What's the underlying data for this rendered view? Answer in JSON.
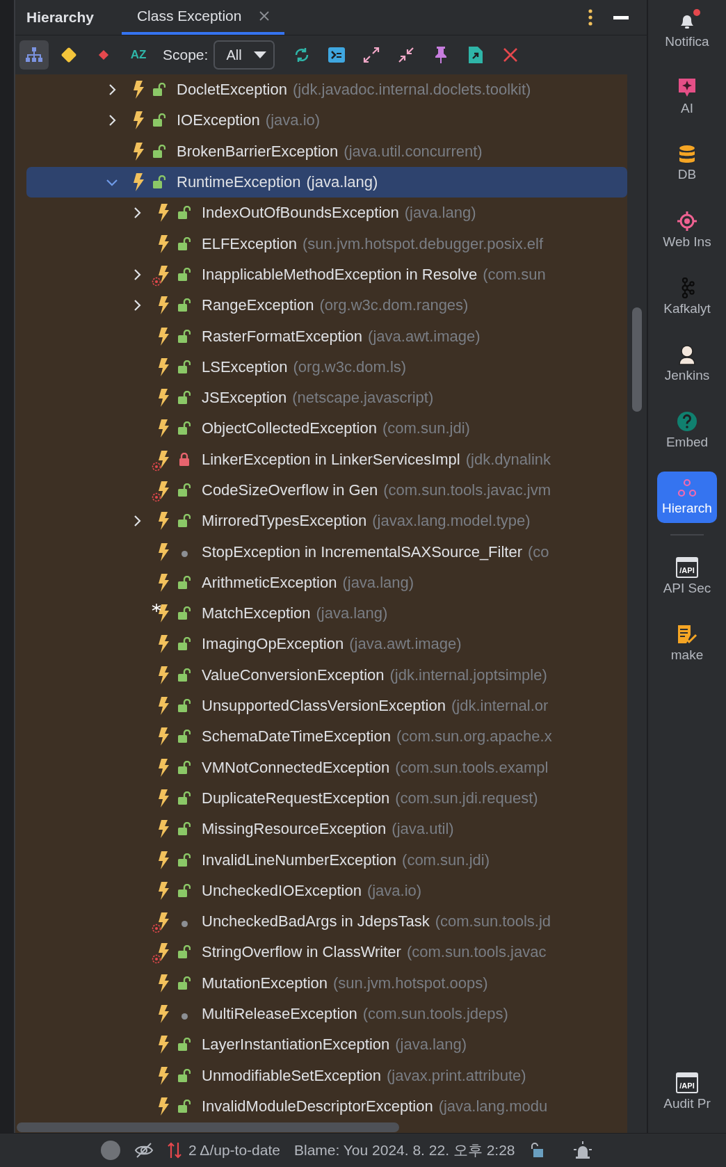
{
  "panel": {
    "title": "Hierarchy",
    "tabs": [
      {
        "label": "Class Exception",
        "selected": true
      }
    ]
  },
  "toolbar": {
    "buttons": [
      {
        "kind": "hierarchy",
        "selected": true
      },
      {
        "kind": "diamond",
        "selected": false
      },
      {
        "kind": "small-diamond",
        "selected": false
      },
      {
        "kind": "sort",
        "label": "AZ",
        "selected": false
      }
    ],
    "scope": {
      "label": "Scope:",
      "value": "All"
    },
    "actions": [
      {
        "kind": "refresh"
      },
      {
        "kind": "terminal"
      },
      {
        "kind": "expand"
      },
      {
        "kind": "collapse"
      },
      {
        "kind": "pin"
      },
      {
        "kind": "export"
      },
      {
        "kind": "close"
      }
    ]
  },
  "tree": [
    {
      "name": "DocletException",
      "package": "(jdk.javadoc.internal.doclets.toolkit)",
      "kind": "public",
      "expanded": false,
      "selected": false,
      "badge_target": false,
      "badge_asterisk": false
    },
    {
      "name": "IOException",
      "package": "(java.io)",
      "kind": "public",
      "expanded": false,
      "selected": false,
      "badge_target": false,
      "badge_asterisk": false
    },
    {
      "name": "BrokenBarrierException",
      "package": "(java.util.concurrent)",
      "kind": "public",
      "selected": false,
      "badge_target": false,
      "badge_asterisk": false
    },
    {
      "name": "RuntimeException",
      "package": "(java.lang)",
      "kind": "public",
      "expanded": true,
      "selected": true,
      "badge_target": false,
      "badge_asterisk": false,
      "children": [
        {
          "name": "IndexOutOfBoundsException",
          "package": "(java.lang)",
          "kind": "public",
          "expanded": false,
          "selected": false,
          "badge_target": false,
          "badge_asterisk": false
        },
        {
          "name": "ELFException",
          "package": "(sun.jvm.hotspot.debugger.posix.elf",
          "kind": "public",
          "selected": false,
          "badge_target": false,
          "badge_asterisk": false
        },
        {
          "name": "InapplicableMethodException in Resolve",
          "package": "(com.sun",
          "kind": "public",
          "expanded": false,
          "selected": false,
          "badge_target": true,
          "badge_asterisk": false
        },
        {
          "name": "RangeException",
          "package": "(org.w3c.dom.ranges)",
          "kind": "public",
          "expanded": false,
          "selected": false,
          "badge_target": false,
          "badge_asterisk": false
        },
        {
          "name": "RasterFormatException",
          "package": "(java.awt.image)",
          "kind": "public",
          "selected": false,
          "badge_target": false,
          "badge_asterisk": false
        },
        {
          "name": "LSException",
          "package": "(org.w3c.dom.ls)",
          "kind": "public",
          "selected": false,
          "badge_target": false,
          "badge_asterisk": false
        },
        {
          "name": "JSException",
          "package": "(netscape.javascript)",
          "kind": "public",
          "selected": false,
          "badge_target": false,
          "badge_asterisk": false
        },
        {
          "name": "ObjectCollectedException",
          "package": "(com.sun.jdi)",
          "kind": "public",
          "selected": false,
          "badge_target": false,
          "badge_asterisk": false
        },
        {
          "name": "LinkerException in LinkerServicesImpl",
          "package": "(jdk.dynalink",
          "kind": "private",
          "selected": false,
          "badge_target": true,
          "badge_asterisk": false
        },
        {
          "name": "CodeSizeOverflow in Gen",
          "package": "(com.sun.tools.javac.jvm",
          "kind": "public",
          "selected": false,
          "badge_target": true,
          "badge_asterisk": false
        },
        {
          "name": "MirroredTypesException",
          "package": "(javax.lang.model.type)",
          "kind": "public",
          "expanded": false,
          "selected": false,
          "badge_target": false,
          "badge_asterisk": false
        },
        {
          "name": "StopException in IncrementalSAXSource_Filter",
          "package": "(co",
          "kind": "package",
          "selected": false,
          "badge_target": false,
          "badge_asterisk": false
        },
        {
          "name": "ArithmeticException",
          "package": "(java.lang)",
          "kind": "public",
          "selected": false,
          "badge_target": false,
          "badge_asterisk": false
        },
        {
          "name": "MatchException",
          "package": "(java.lang)",
          "kind": "public",
          "selected": false,
          "badge_target": false,
          "badge_asterisk": true
        },
        {
          "name": "ImagingOpException",
          "package": "(java.awt.image)",
          "kind": "public",
          "selected": false,
          "badge_target": false,
          "badge_asterisk": false
        },
        {
          "name": "ValueConversionException",
          "package": "(jdk.internal.joptsimple)",
          "kind": "public",
          "selected": false,
          "badge_target": false,
          "badge_asterisk": false
        },
        {
          "name": "UnsupportedClassVersionException",
          "package": "(jdk.internal.or",
          "kind": "public",
          "selected": false,
          "badge_target": false,
          "badge_asterisk": false
        },
        {
          "name": "SchemaDateTimeException",
          "package": "(com.sun.org.apache.x",
          "kind": "public",
          "selected": false,
          "badge_target": false,
          "badge_asterisk": false
        },
        {
          "name": "VMNotConnectedException",
          "package": "(com.sun.tools.exampl",
          "kind": "public",
          "selected": false,
          "badge_target": false,
          "badge_asterisk": false
        },
        {
          "name": "DuplicateRequestException",
          "package": "(com.sun.jdi.request)",
          "kind": "public",
          "selected": false,
          "badge_target": false,
          "badge_asterisk": false
        },
        {
          "name": "MissingResourceException",
          "package": "(java.util)",
          "kind": "public",
          "selected": false,
          "badge_target": false,
          "badge_asterisk": false
        },
        {
          "name": "InvalidLineNumberException",
          "package": "(com.sun.jdi)",
          "kind": "public",
          "selected": false,
          "badge_target": false,
          "badge_asterisk": false
        },
        {
          "name": "UncheckedIOException",
          "package": "(java.io)",
          "kind": "public",
          "selected": false,
          "badge_target": false,
          "badge_asterisk": false
        },
        {
          "name": "UncheckedBadArgs in JdepsTask",
          "package": "(com.sun.tools.jd",
          "kind": "package",
          "selected": false,
          "badge_target": true,
          "badge_asterisk": false
        },
        {
          "name": "StringOverflow in ClassWriter",
          "package": "(com.sun.tools.javac",
          "kind": "public",
          "selected": false,
          "badge_target": true,
          "badge_asterisk": false
        },
        {
          "name": "MutationException",
          "package": "(sun.jvm.hotspot.oops)",
          "kind": "public",
          "selected": false,
          "badge_target": false,
          "badge_asterisk": false
        },
        {
          "name": "MultiReleaseException",
          "package": "(com.sun.tools.jdeps)",
          "kind": "package",
          "selected": false,
          "badge_target": false,
          "badge_asterisk": false
        },
        {
          "name": "LayerInstantiationException",
          "package": "(java.lang)",
          "kind": "public",
          "selected": false,
          "badge_target": false,
          "badge_asterisk": false
        },
        {
          "name": "UnmodifiableSetException",
          "package": "(javax.print.attribute)",
          "kind": "public",
          "selected": false,
          "badge_target": false,
          "badge_asterisk": false
        },
        {
          "name": "InvalidModuleDescriptorException",
          "package": "(java.lang.modu",
          "kind": "public",
          "selected": false,
          "badge_target": false,
          "badge_asterisk": false
        }
      ]
    }
  ],
  "sidebar": {
    "items": [
      {
        "label": "Notifica",
        "kind": "bell",
        "notify": true,
        "selected": false
      },
      {
        "label": "AI",
        "kind": "ai",
        "notify": false,
        "selected": false
      },
      {
        "label": "DB",
        "kind": "db",
        "notify": false,
        "selected": false
      },
      {
        "label": "Web Ins",
        "kind": "target",
        "notify": false,
        "selected": false
      },
      {
        "label": "Kafkalyt",
        "kind": "kafka",
        "notify": false,
        "selected": false
      },
      {
        "label": "Jenkins",
        "kind": "person",
        "notify": false,
        "selected": false
      },
      {
        "label": "Embed",
        "kind": "help",
        "notify": false,
        "selected": false
      },
      {
        "label": "Hierarch",
        "kind": "hierarchy",
        "notify": false,
        "selected": true
      },
      {
        "label": "API Sec",
        "kind": "api",
        "glyph": "/API",
        "notify": false,
        "selected": false
      },
      {
        "label": "make",
        "kind": "make",
        "notify": false,
        "selected": false
      }
    ],
    "bottom_items": [
      {
        "label": "Audit Pr",
        "kind": "api",
        "glyph": "/API",
        "notify": false,
        "selected": false
      }
    ]
  },
  "status_bar": {
    "vcs": "2 Δ/up-to-date",
    "blame": "Blame: You 2024. 8. 22. 오후 2:28"
  }
}
